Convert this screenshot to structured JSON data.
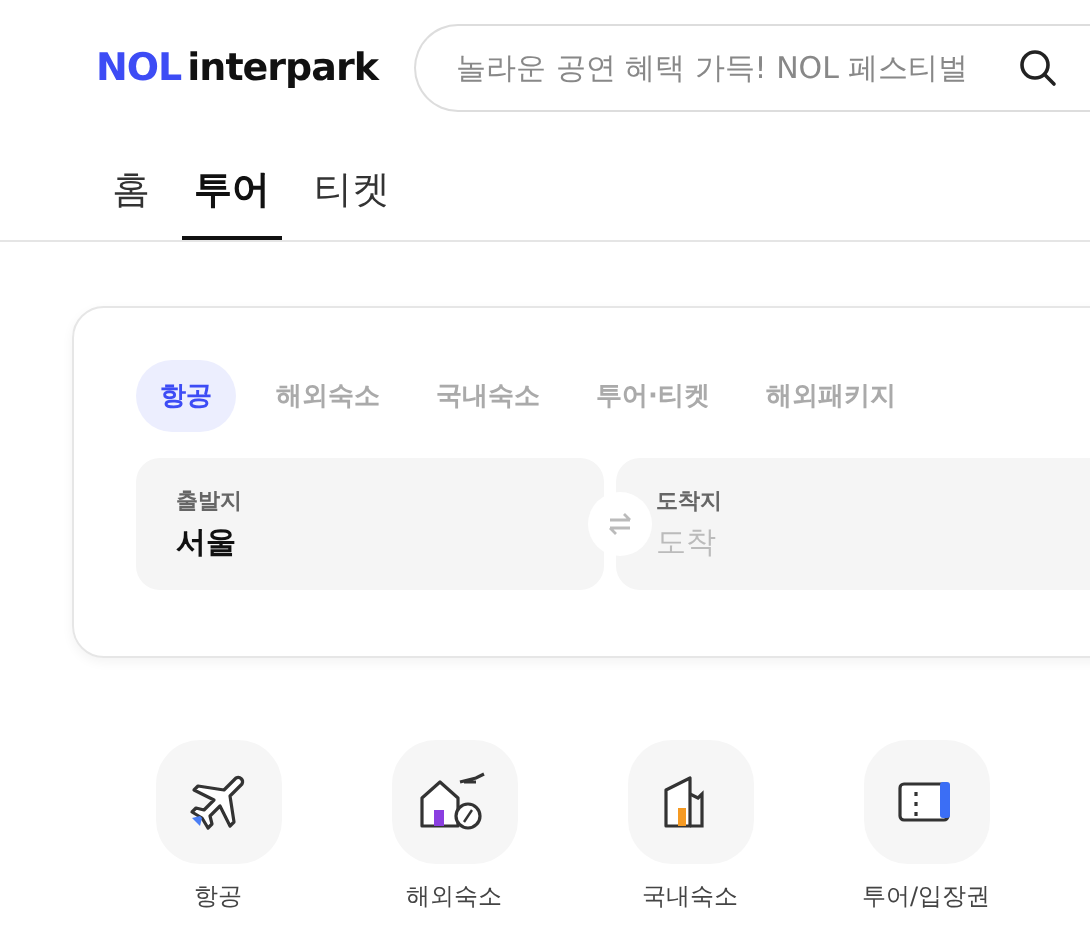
{
  "header": {
    "logo": {
      "brand": "NOL",
      "name": "interpark"
    },
    "search": {
      "placeholder": "놀라운 공연 혜택 가득! NOL 페스티벌"
    }
  },
  "tabs": [
    {
      "label": "홈",
      "selected": false
    },
    {
      "label": "투어",
      "selected": true
    },
    {
      "label": "티켓",
      "selected": false
    }
  ],
  "search_card": {
    "categories": [
      {
        "label": "항공",
        "selected": true
      },
      {
        "label": "해외숙소",
        "selected": false
      },
      {
        "label": "국내숙소",
        "selected": false
      },
      {
        "label": "투어·티켓",
        "selected": false
      },
      {
        "label": "해외패키지",
        "selected": false
      }
    ],
    "origin": {
      "label": "출발지",
      "value": "서울"
    },
    "destination": {
      "label": "도착지",
      "placeholder": "도착"
    }
  },
  "shortcuts": [
    {
      "kind": "plane",
      "label": "항공"
    },
    {
      "kind": "hotel",
      "label": "해외숙소"
    },
    {
      "kind": "house",
      "label": "국내숙소"
    },
    {
      "kind": "ticket",
      "label": "투어/입장권"
    }
  ]
}
